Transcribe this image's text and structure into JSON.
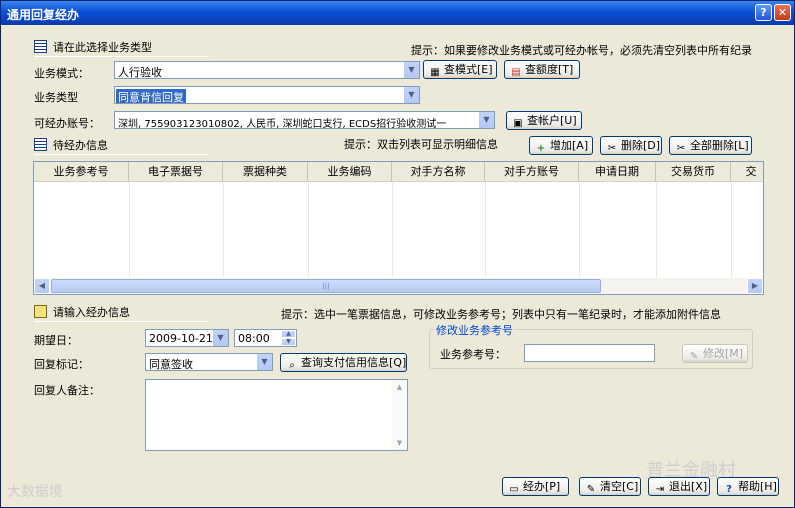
{
  "window": {
    "title": "通用回复经办",
    "help_glyph": "?",
    "close_glyph": "✕"
  },
  "select_section": {
    "title": "请在此选择业务类型",
    "hint": "提示：如果要修改业务模式或可经办帐号，必须先清空列表中所有纪录"
  },
  "form": {
    "mode_label": "业务模式：",
    "mode_value": "人行验收",
    "type_label": "业务类型",
    "type_value": "同意背信回复",
    "account_label": "可经办账号：",
    "account_value": "深圳, 755903123010802, 人民币, 深圳蛇口支行, ECDS招行验收测试一"
  },
  "buttons": {
    "query_mode": "查模式[E]",
    "query_limit": "查额度[T]",
    "query_account": "查帐户[U]",
    "add": "增加[A]",
    "delete": "删除[D]",
    "delete_all": "全部删除[L]",
    "modify": "修改[M]",
    "handle": "经办[P]",
    "clear": "清空[C]",
    "exit": "退出[X]",
    "help": "帮助[H]",
    "query_credit": "查询支付信用信息[Q]"
  },
  "pending_section": {
    "title": "待经办信息",
    "hint": "提示：双击列表可显示明细信息"
  },
  "table": {
    "columns": [
      "业务参考号",
      "电子票据号",
      "票据种类",
      "业务编码",
      "对手方名称",
      "对手方账号",
      "申请日期",
      "交易货币",
      "交"
    ],
    "rows": []
  },
  "input_section": {
    "title": "请输入经办信息",
    "hint": "提示：选中一笔票据信息，可修改业务参考号；列表中只有一笔纪录时，才能添加附件信息"
  },
  "handling": {
    "date_label": "期望日：",
    "date_value": "2009-10-21",
    "time_value": "08:00",
    "reply_label": "回复标记：",
    "reply_value": "同意签收",
    "remark_label": "回复人备注："
  },
  "modify_group": {
    "legend": "修改业务参考号",
    "ref_label": "业务参考号：",
    "ref_value": ""
  },
  "watermarks": {
    "left": "大数据境",
    "right": "普兰金融村"
  },
  "colors": {
    "titlebar": "#0a4fd4",
    "selection": "#316ac5",
    "window_bg": "#ece9d8",
    "group_legend": "#0046d5"
  }
}
